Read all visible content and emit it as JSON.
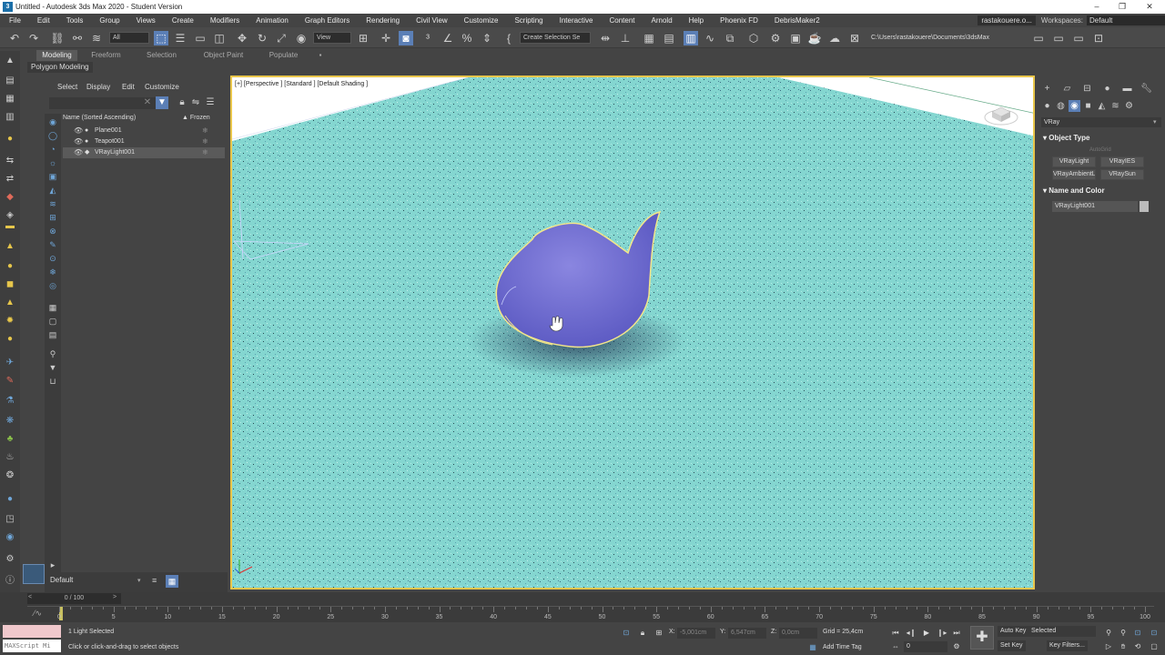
{
  "window": {
    "title": "Untitled - Autodesk 3ds Max 2020 - Student Version",
    "minimize": "–",
    "maximize": "❐",
    "close": "✕"
  },
  "menu": {
    "items": [
      "File",
      "Edit",
      "Tools",
      "Group",
      "Views",
      "Create",
      "Modifiers",
      "Animation",
      "Graph Editors",
      "Rendering",
      "Civil View",
      "Customize",
      "Scripting",
      "Interactive",
      "Content",
      "Arnold",
      "Help",
      "Phoenix FD",
      "DebrisMaker2"
    ],
    "user": "rastakouere.o...",
    "workspaces_label": "Workspaces:",
    "workspace_value": "Default"
  },
  "toolbar": {
    "selection_filter": "All",
    "ref_coord": "View",
    "named_selection": "Create Selection Se",
    "project_path": "C:\\Users\\rastakouere\\Documents\\3dsMax"
  },
  "ribbon": {
    "tabs": [
      "Modeling",
      "Freeform",
      "Selection",
      "Object Paint",
      "Populate"
    ],
    "active_tab": "Modeling",
    "sub_label": "Polygon Modeling"
  },
  "explorer": {
    "menu": [
      "Select",
      "Display",
      "Edit",
      "Customize"
    ],
    "col_name": "Name (Sorted Ascending)",
    "col_frozen": "▲ Frozen",
    "rows": [
      {
        "name": "Plane001",
        "selected": false
      },
      {
        "name": "Teapot001",
        "selected": false
      },
      {
        "name": "VRayLight001",
        "selected": true
      }
    ],
    "layer": "Default"
  },
  "viewport": {
    "label": "[+] [Perspective ] [Standard ] [Default Shading ]"
  },
  "command_panel": {
    "category": "VRay",
    "object_type_title": "Object Type",
    "autogrid": "AutoGrid",
    "buttons": [
      "VRayLight",
      "VRayIES",
      "VRayAmbientLight",
      "VRaySun"
    ],
    "name_color_title": "Name and Color",
    "object_name": "VRayLight001",
    "swatch_color": "#bbbbbb"
  },
  "timeline": {
    "frame_display": "0 / 100",
    "ticks": [
      "0",
      "5",
      "10",
      "15",
      "20",
      "25",
      "30",
      "35",
      "40",
      "45",
      "50",
      "55",
      "60",
      "65",
      "70",
      "75",
      "80",
      "85",
      "90",
      "95",
      "100"
    ]
  },
  "status": {
    "maxscript": "MAXScript Mi",
    "selection": "1 Light Selected",
    "prompt": "Click or click-and-drag to select objects",
    "x_label": "X:",
    "x_value": "-5,001cm",
    "y_label": "Y:",
    "y_value": "6,547cm",
    "z_label": "Z:",
    "z_value": "0,0cm",
    "grid": "Grid = 25,4cm",
    "add_time_tag": "Add Time Tag",
    "auto_key": "Auto Key",
    "selected_dropdown": "Selected",
    "set_key": "Set Key",
    "key_filters": "Key Filters...",
    "frame": "0"
  }
}
